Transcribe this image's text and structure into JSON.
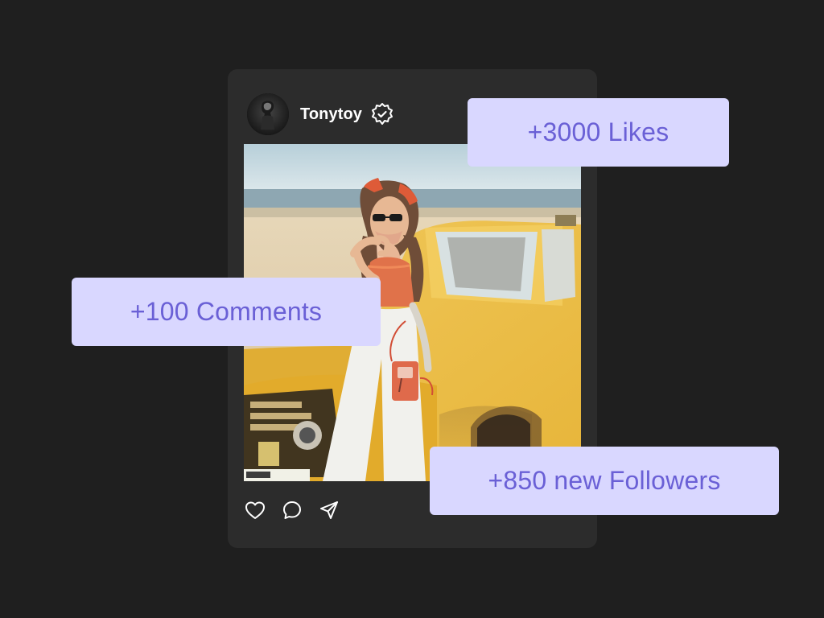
{
  "post": {
    "username": "Tonytoy",
    "avatar_icon": "profile-photo",
    "verified_icon": "verified-badge-icon",
    "image_icon": "post-photo",
    "actions": [
      {
        "name": "like",
        "icon": "heart-icon"
      },
      {
        "name": "comment",
        "icon": "comment-icon"
      },
      {
        "name": "share",
        "icon": "send-icon"
      }
    ]
  },
  "stats": {
    "likes": "+3000 Likes",
    "comments": "+100 Comments",
    "followers": "+850 new Followers"
  },
  "colors": {
    "background": "#1f1f1f",
    "card": "#2c2c2c",
    "tag_background": "#d9d7ff",
    "tag_text": "#6a60d6",
    "username": "#ffffff"
  }
}
